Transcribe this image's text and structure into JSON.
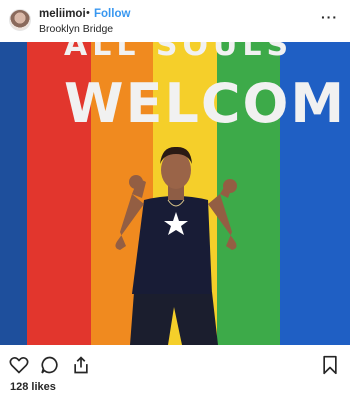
{
  "post": {
    "username": "meliimoi",
    "separator": "•",
    "follow_label": "Follow",
    "location": "Brooklyn Bridge",
    "more_label": "···",
    "likes_text": "128 likes"
  },
  "photo": {
    "wall_text_top": "ALL SOULS",
    "wall_text_main": "WELCOME",
    "stripe_colors": [
      "#1e4f9c",
      "#e2362d",
      "#f08a1f",
      "#f5cf2a",
      "#3daa49",
      "#1f5fc4"
    ]
  },
  "icons": {
    "like": "heart-icon",
    "comment": "comment-icon",
    "share": "share-icon",
    "save": "bookmark-icon"
  }
}
